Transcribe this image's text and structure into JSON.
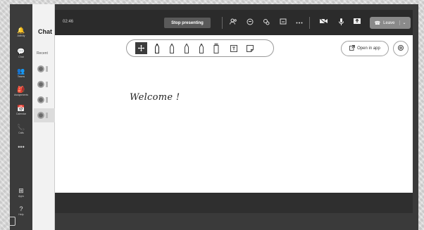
{
  "rail": {
    "items": [
      {
        "icon": "bell-icon",
        "glyph": "🔔",
        "label": "Activity"
      },
      {
        "icon": "chat-icon",
        "glyph": "💬",
        "label": "Chat"
      },
      {
        "icon": "teams-icon",
        "glyph": "👥",
        "label": "Teams"
      },
      {
        "icon": "assignments-icon",
        "glyph": "🎒",
        "label": "Assignments"
      },
      {
        "icon": "calendar-icon",
        "glyph": "📅",
        "label": "Calendar"
      },
      {
        "icon": "calls-icon",
        "glyph": "📞",
        "label": "Calls"
      }
    ],
    "more": "•••",
    "apps": {
      "icon": "apps-icon",
      "glyph": "⊞",
      "label": "Apps"
    },
    "help": {
      "icon": "help-icon",
      "glyph": "?",
      "label": "Help"
    }
  },
  "chat_panel": {
    "title": "Chat",
    "recent_label": "Recent"
  },
  "meeting": {
    "timer": "02:46",
    "stop_presenting": "Stop presenting",
    "leave": "Leave",
    "topbar_icons": [
      "people-icon",
      "chat-bubble-icon",
      "reactions-icon",
      "share-tray-icon",
      "more-icon",
      "camera-icon",
      "mic-icon",
      "share-icon"
    ]
  },
  "whiteboard": {
    "open_in_app": "Open in app",
    "text": "Welcome !",
    "tools": [
      "move-tool-icon",
      "black-pen-icon",
      "red-pen-icon",
      "green-pen-icon",
      "blue-pen-icon",
      "highlighter-icon",
      "text-tool-icon",
      "sticky-note-icon"
    ]
  },
  "colors": {
    "topbar": "#2b2b2b",
    "rail": "#3b3b3b",
    "canvas": "#ffffff",
    "selected_tool": "#3c3c3c",
    "leave_button": "#8a8a8a"
  }
}
